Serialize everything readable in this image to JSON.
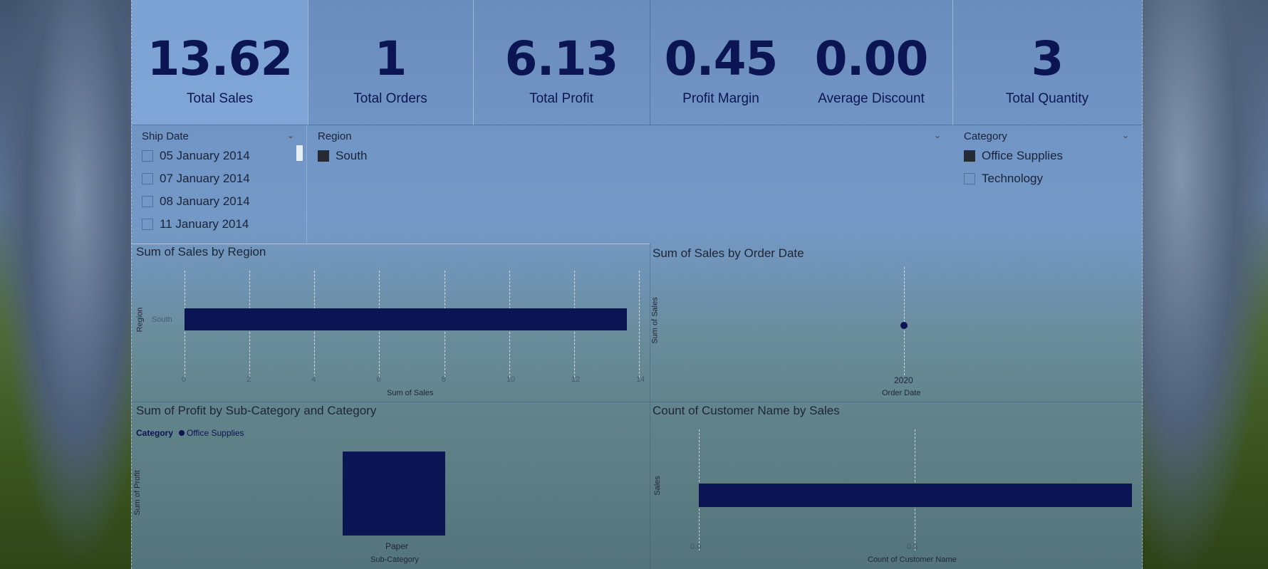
{
  "kpis": [
    {
      "value": "13.62",
      "label": "Total Sales"
    },
    {
      "value": "1",
      "label": "Total Orders"
    },
    {
      "value": "6.13",
      "label": "Total Profit"
    },
    {
      "value": "0.45",
      "label": "Profit Margin"
    },
    {
      "value": "0.00",
      "label": "Average Discount"
    },
    {
      "value": "3",
      "label": "Total Quantity"
    }
  ],
  "slicers": {
    "ship_date": {
      "title": "Ship Date",
      "items": [
        "05 January 2014",
        "07 January 2014",
        "08 January 2014",
        "11 January 2014"
      ]
    },
    "region": {
      "title": "Region",
      "items": [
        "South"
      ]
    },
    "category": {
      "title": "Category",
      "items": [
        "Office Supplies",
        "Technology"
      ]
    }
  },
  "colors": {
    "accent": "#0c1553"
  },
  "chart_data": [
    {
      "id": "sales-by-region",
      "type": "bar",
      "title": "Sum of Sales by Region",
      "xlabel": "Sum of Sales",
      "ylabel": "Region",
      "categories": [
        "South"
      ],
      "values": [
        13.62
      ],
      "xticks": [
        "0",
        "2",
        "4",
        "6",
        "8",
        "10",
        "12",
        "14"
      ],
      "xlim": [
        0,
        14
      ]
    },
    {
      "id": "sales-by-order-date",
      "type": "scatter",
      "title": "Sum of Sales by Order Date",
      "xlabel": "Order Date",
      "ylabel": "Sum of Sales",
      "x": [
        "2020"
      ],
      "values": [
        13.62
      ]
    },
    {
      "id": "profit-by-subcategory",
      "type": "bar",
      "title": "Sum of Profit by Sub-Category and Category",
      "xlabel": "Sub-Category",
      "ylabel": "Sum of Profit",
      "legend_title": "Category",
      "series": [
        {
          "name": "Office Supplies",
          "values": [
            6.13
          ]
        }
      ],
      "categories": [
        "Paper"
      ]
    },
    {
      "id": "count-customer-by-sales",
      "type": "bar",
      "title": "Count of Customer Name by Sales",
      "xlabel": "Count of Customer Name",
      "ylabel": "Sales",
      "xticks": [
        "0.0",
        "0.5"
      ],
      "values": [
        1
      ]
    }
  ]
}
